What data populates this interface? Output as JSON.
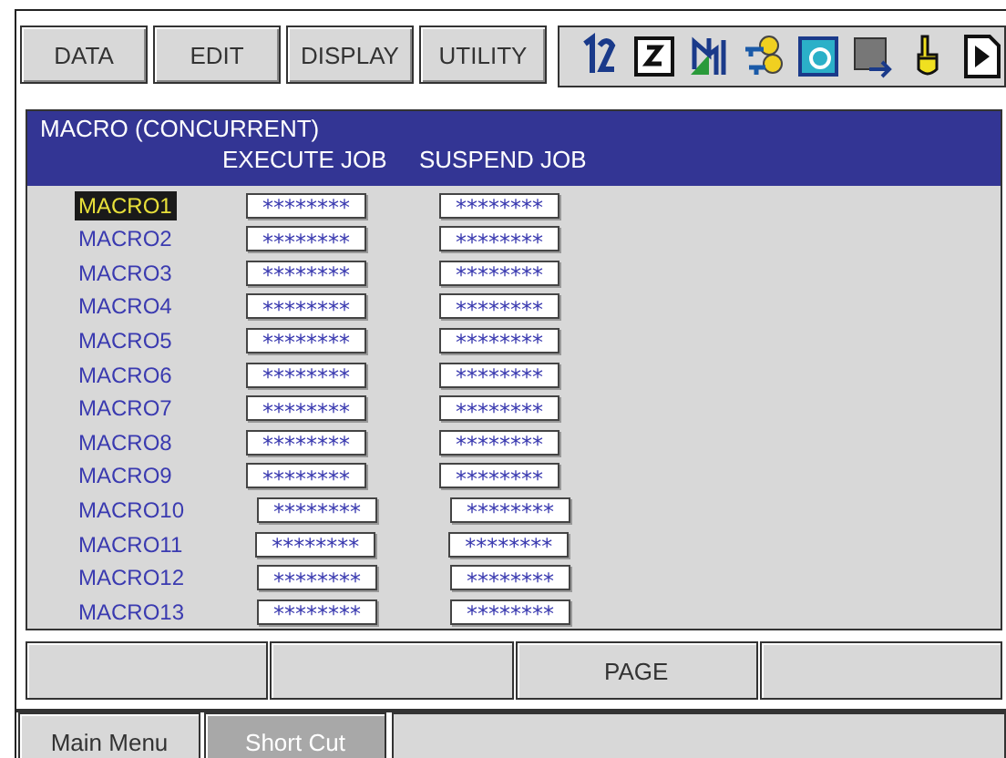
{
  "menu": [
    {
      "label": "DATA"
    },
    {
      "label": "EDIT"
    },
    {
      "label": "DISPLAY"
    },
    {
      "label": "UTILITY"
    }
  ],
  "toolbar_icons": [
    {
      "kind": "numbers"
    },
    {
      "kind": "frame"
    },
    {
      "kind": "chart"
    },
    {
      "kind": "keys"
    },
    {
      "kind": "coordinate"
    },
    {
      "kind": "exit"
    },
    {
      "kind": "hand"
    },
    {
      "kind": "play"
    }
  ],
  "panel": {
    "title": "MACRO  (CONCURRENT)",
    "columns": [
      "EXECUTE JOB",
      "SUSPEND JOB"
    ],
    "rows": [
      {
        "name": "MACRO1",
        "execute_job": "********",
        "suspend_job": "********",
        "selected": true
      },
      {
        "name": "MACRO2",
        "execute_job": "********",
        "suspend_job": "********",
        "selected": false
      },
      {
        "name": "MACRO3",
        "execute_job": "********",
        "suspend_job": "********",
        "selected": false
      },
      {
        "name": "MACRO4",
        "execute_job": "********",
        "suspend_job": "********",
        "selected": false
      },
      {
        "name": "MACRO5",
        "execute_job": "********",
        "suspend_job": "********",
        "selected": false
      },
      {
        "name": "MACRO6",
        "execute_job": "********",
        "suspend_job": "********",
        "selected": false
      },
      {
        "name": "MACRO7",
        "execute_job": "********",
        "suspend_job": "********",
        "selected": false
      },
      {
        "name": "MACRO8",
        "execute_job": "********",
        "suspend_job": "********",
        "selected": false
      },
      {
        "name": "MACRO9",
        "execute_job": "********",
        "suspend_job": "********",
        "selected": false
      },
      {
        "name": "MACRO10",
        "execute_job": "********",
        "suspend_job": "********",
        "selected": false
      },
      {
        "name": "MACRO11",
        "execute_job": "********",
        "suspend_job": "********",
        "selected": false
      },
      {
        "name": "MACRO12",
        "execute_job": "********",
        "suspend_job": "********",
        "selected": false
      },
      {
        "name": "MACRO13",
        "execute_job": "********",
        "suspend_job": "********",
        "selected": false
      }
    ]
  },
  "function_keys": [
    {
      "kind": "blank"
    },
    {
      "kind": "blank"
    },
    {
      "kind": "label",
      "label": "PAGE"
    },
    {
      "kind": "blank"
    }
  ],
  "bottom_bar": [
    {
      "label": "Main Menu",
      "disabled": false
    },
    {
      "label": "Short Cut",
      "disabled": true
    }
  ]
}
